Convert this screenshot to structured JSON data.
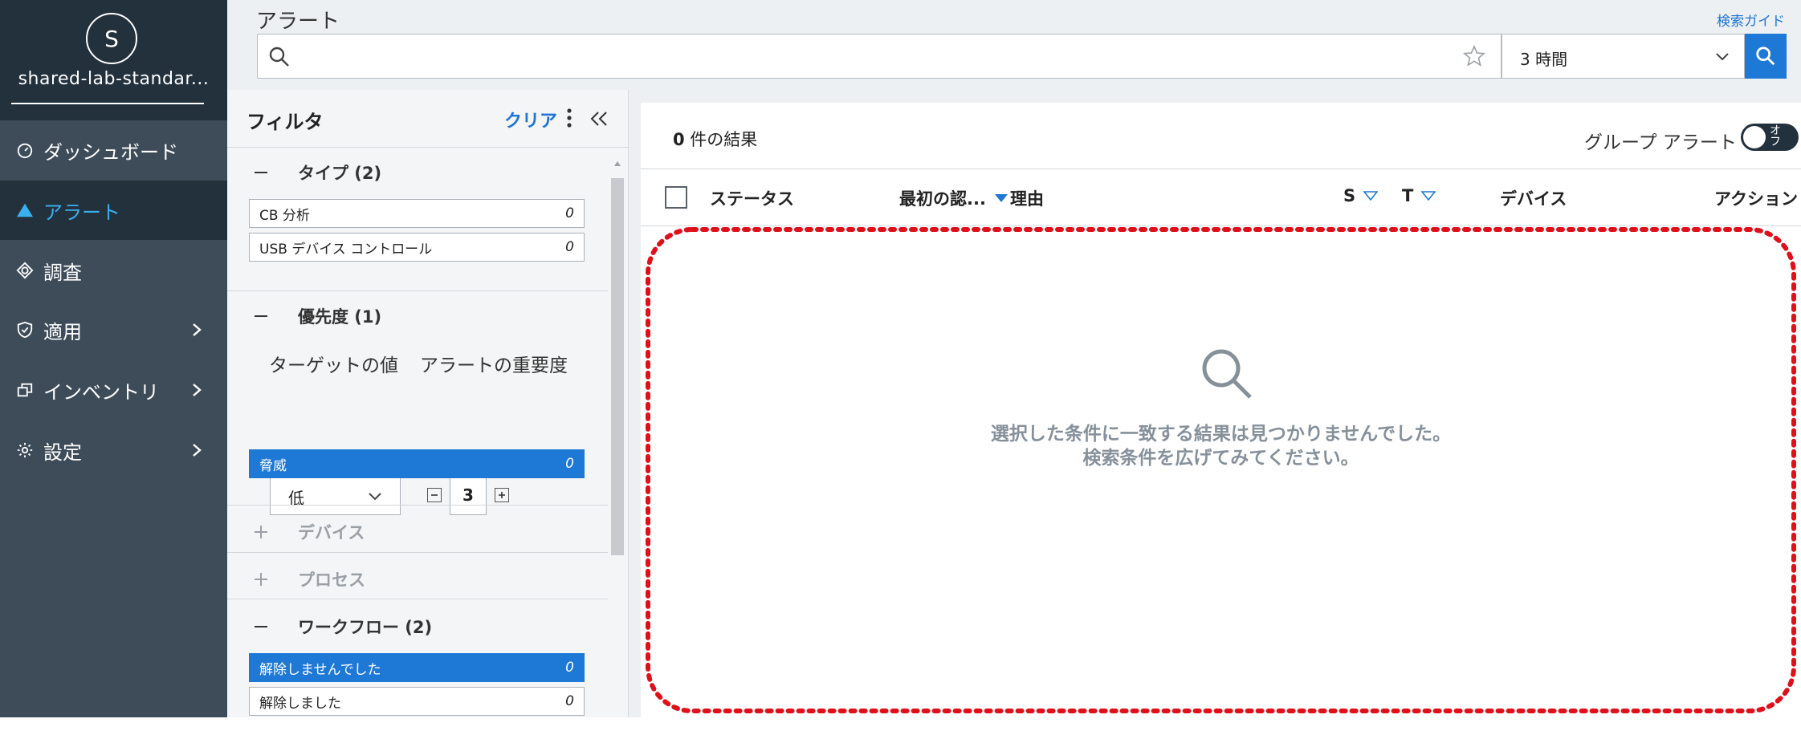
{
  "org": {
    "avatar_letter": "S",
    "name": "shared-lab-standar..."
  },
  "nav": {
    "items": [
      {
        "label": "ダッシュボード",
        "icon": "dashboard-icon",
        "active": false,
        "has_submenu": false
      },
      {
        "label": "アラート",
        "icon": "alert-triangle-icon",
        "active": true,
        "has_submenu": false
      },
      {
        "label": "調査",
        "icon": "investigate-icon",
        "active": false,
        "has_submenu": false
      },
      {
        "label": "適用",
        "icon": "shield-check-icon",
        "active": false,
        "has_submenu": true
      },
      {
        "label": "インベントリ",
        "icon": "inventory-icon",
        "active": false,
        "has_submenu": true
      },
      {
        "label": "設定",
        "icon": "gear-icon",
        "active": false,
        "has_submenu": true
      }
    ]
  },
  "header": {
    "title": "アラート",
    "search_guide": "検索ガイド",
    "search_placeholder": "",
    "time_range": "3 時間"
  },
  "filter": {
    "title": "フィルタ",
    "clear_label": "クリア",
    "sections": {
      "type": {
        "title": "タイプ (2)",
        "options": [
          {
            "label": "CB 分析",
            "count": "0"
          },
          {
            "label": "USB デバイス コントロール",
            "count": "0"
          }
        ]
      },
      "priority": {
        "title": "優先度 (1)",
        "target_label": "ターゲットの値",
        "severity_label": "アラートの重要度",
        "target_value": "低",
        "severity_value": "3",
        "options": [
          {
            "label": "脅威",
            "count": "0",
            "selected": true
          }
        ]
      },
      "device": {
        "title": "デバイス"
      },
      "process": {
        "title": "プロセス"
      },
      "workflow": {
        "title": "ワークフロー (2)",
        "options": [
          {
            "label": "解除しませんでした",
            "count": "0",
            "selected": true
          },
          {
            "label": "解除しました",
            "count": "0",
            "selected": false
          }
        ]
      }
    }
  },
  "results": {
    "count": "0",
    "count_suffix": " 件の結果",
    "group_alerts_label": "グループ アラート",
    "toggle_label": "オフ",
    "columns": {
      "status": "ステータス",
      "first_seen": "最初の認...",
      "reason": "理由",
      "s": "S",
      "t": "T",
      "device": "デバイス",
      "action": "アクション"
    },
    "empty_line1": "選択した条件に一致する結果は見つかりませんでした。",
    "empty_line2": "検索条件を広げてみてください。"
  },
  "colors": {
    "accent": "#1e78d6",
    "sidebar": "#3e4c59",
    "sidebar_dark": "#23313d",
    "active_nav": "#3ab0f0",
    "highlight_border": "#e0101a"
  }
}
